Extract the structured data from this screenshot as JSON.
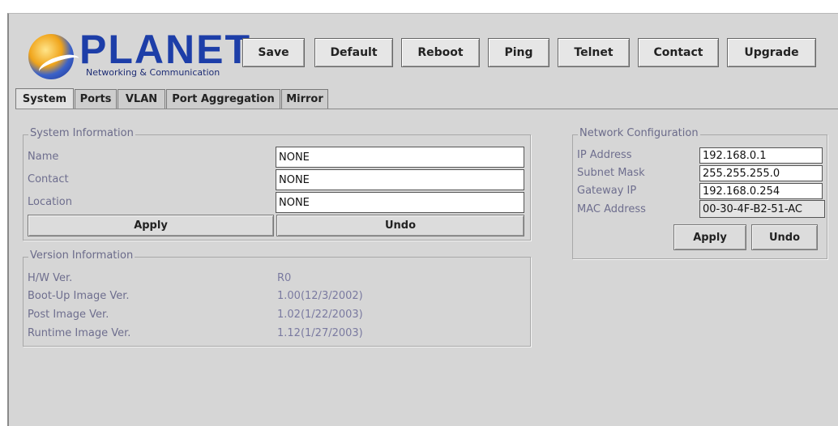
{
  "brand": {
    "name": "PLANET",
    "tagline": "Networking & Communication"
  },
  "toolbar": [
    "Save",
    "Default",
    "Reboot",
    "Ping",
    "Telnet",
    "Contact",
    "Upgrade"
  ],
  "tabs": [
    "System",
    "Ports",
    "VLAN",
    "Port Aggregation",
    "Mirror"
  ],
  "active_tab": "System",
  "system_info": {
    "title": "System Information",
    "fields": [
      {
        "label": "Name",
        "value": "NONE"
      },
      {
        "label": "Contact",
        "value": "NONE"
      },
      {
        "label": "Location",
        "value": "NONE"
      }
    ],
    "apply": "Apply",
    "undo": "Undo"
  },
  "version_info": {
    "title": "Version Information",
    "rows": [
      {
        "label": "H/W Ver.",
        "value": "R0"
      },
      {
        "label": "Boot-Up Image Ver.",
        "value": "1.00(12/3/2002)"
      },
      {
        "label": "Post Image Ver.",
        "value": "1.02(1/22/2003)"
      },
      {
        "label": "Runtime Image Ver.",
        "value": "1.12(1/27/2003)"
      }
    ]
  },
  "network_config": {
    "title": "Network Configuration",
    "fields": [
      {
        "label": "IP Address",
        "value": "192.168.0.1"
      },
      {
        "label": "Subnet Mask",
        "value": "255.255.255.0"
      },
      {
        "label": "Gateway IP",
        "value": "192.168.0.254"
      },
      {
        "label": "MAC Address",
        "value": "00-30-4F-B2-51-AC"
      }
    ],
    "apply": "Apply",
    "undo": "Undo"
  },
  "colors": {
    "brand_blue": "#1d3ea8",
    "label_text": "#6e6e8e",
    "panel_bg": "#d6d6d6"
  }
}
